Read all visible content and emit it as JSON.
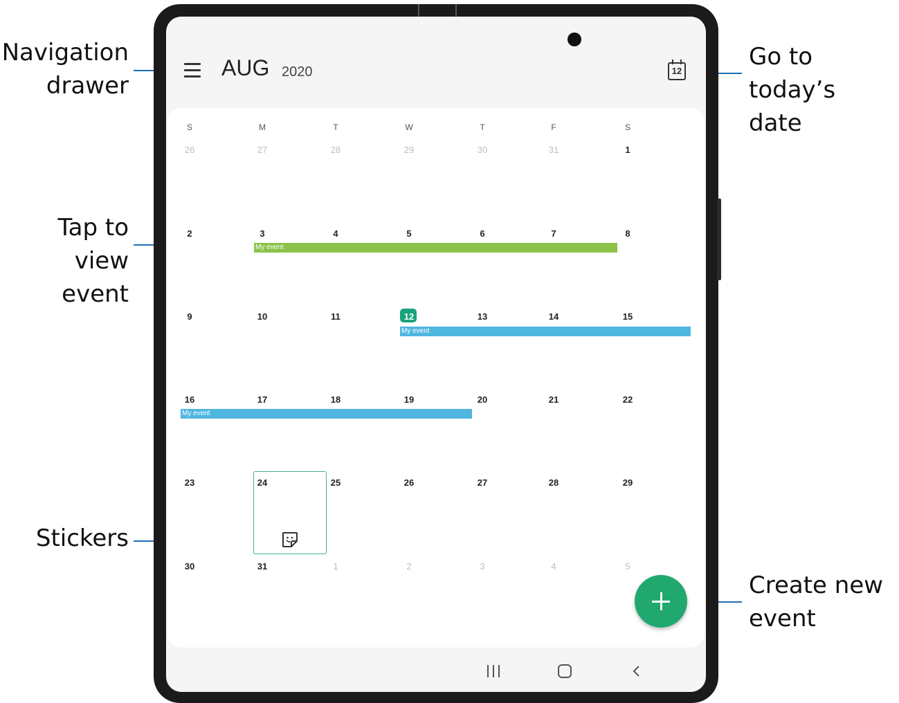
{
  "callouts": {
    "navigation_drawer": [
      "Navigation",
      "drawer"
    ],
    "tap_to_view_event": [
      "Tap to view",
      "event"
    ],
    "stickers": "Stickers",
    "go_to_today": [
      "Go to today’s",
      "date"
    ],
    "create_new_event": [
      "Create new",
      "event"
    ]
  },
  "header": {
    "month": "AUG",
    "year": "2020",
    "today_icon_number": "12",
    "menu_icon": "hamburger-menu-icon",
    "today_icon": "calendar-today-icon"
  },
  "weekdays": [
    "S",
    "M",
    "T",
    "W",
    "T",
    "F",
    "S"
  ],
  "weeks": [
    [
      "26",
      "27",
      "28",
      "29",
      "30",
      "31",
      "1"
    ],
    [
      "2",
      "3",
      "4",
      "5",
      "6",
      "7",
      "8"
    ],
    [
      "9",
      "10",
      "11",
      "12",
      "13",
      "14",
      "15"
    ],
    [
      "16",
      "17",
      "18",
      "19",
      "20",
      "21",
      "22"
    ],
    [
      "23",
      "24",
      "25",
      "26",
      "27",
      "28",
      "29"
    ],
    [
      "30",
      "31",
      "1",
      "2",
      "3",
      "4",
      "5"
    ]
  ],
  "today": "12",
  "events": [
    {
      "label": "My event",
      "color": "#8bc34a",
      "start": "3",
      "end": "8"
    },
    {
      "label": "My event",
      "color": "#4fb6e0",
      "start": "12",
      "end": "15"
    },
    {
      "label": "My event",
      "color": "#4fb6e0",
      "start": "16",
      "end": "19"
    }
  ],
  "sticker": {
    "day": "24",
    "icon": "sticker-icon"
  },
  "fab_icon": "plus-icon",
  "navbar": {
    "recents": "recents-icon",
    "home": "home-icon",
    "back": "back-icon"
  },
  "colors": {
    "accent": "#21a86e",
    "today": "#1aa37a",
    "leader": "#1f6db5"
  }
}
